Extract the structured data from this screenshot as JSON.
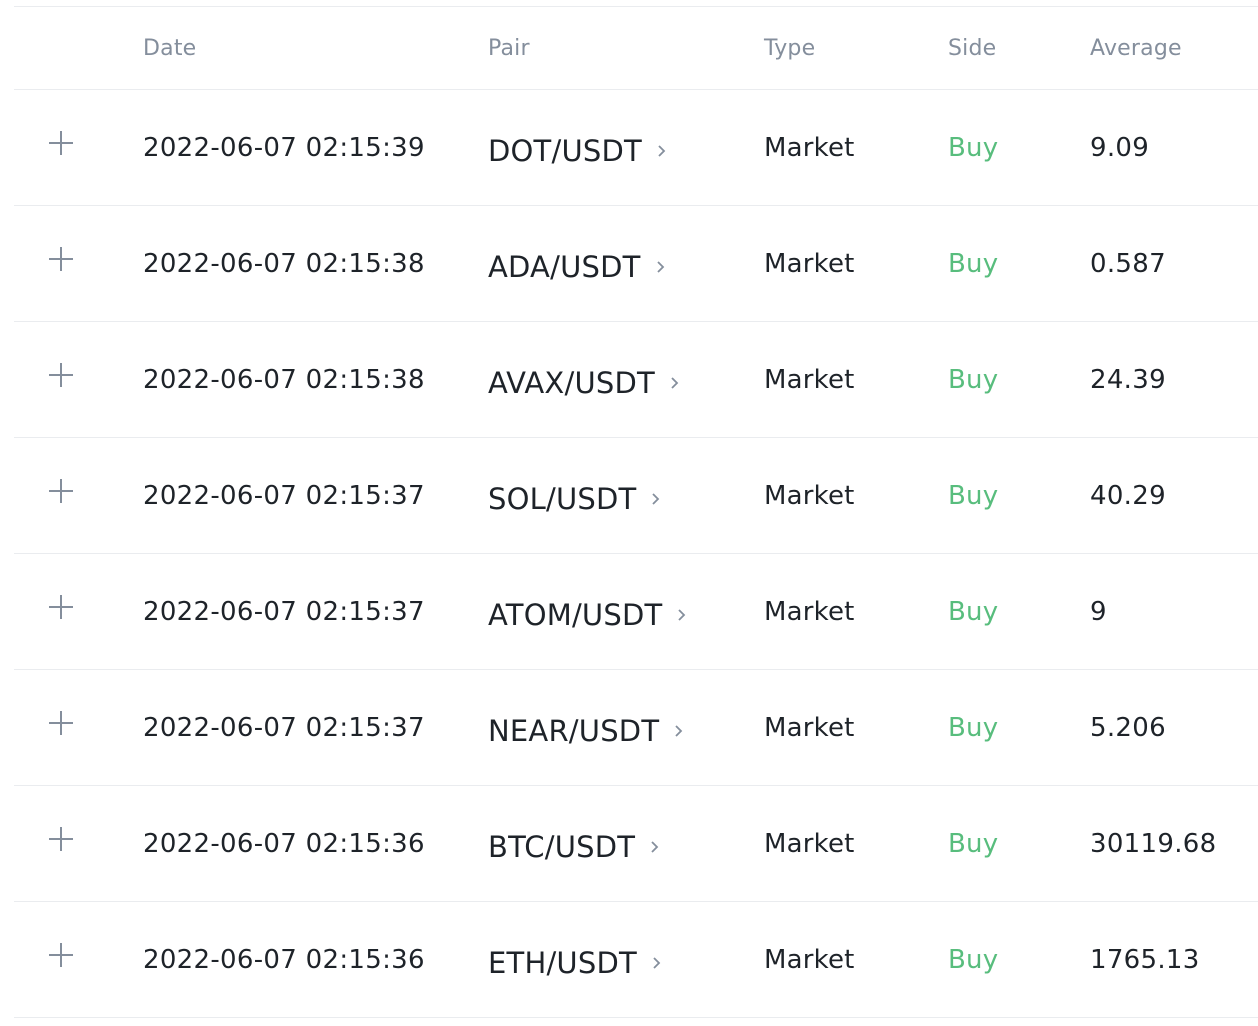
{
  "table": {
    "headers": {
      "date": "Date",
      "pair": "Pair",
      "type": "Type",
      "side": "Side",
      "average": "Average"
    },
    "side_color": "#58bd7d",
    "rows": [
      {
        "date": "2022-06-07 02:15:39",
        "pair": "DOT/USDT",
        "type": "Market",
        "side": "Buy",
        "average": "9.09"
      },
      {
        "date": "2022-06-07 02:15:38",
        "pair": "ADA/USDT",
        "type": "Market",
        "side": "Buy",
        "average": "0.587"
      },
      {
        "date": "2022-06-07 02:15:38",
        "pair": "AVAX/USDT",
        "type": "Market",
        "side": "Buy",
        "average": "24.39"
      },
      {
        "date": "2022-06-07 02:15:37",
        "pair": "SOL/USDT",
        "type": "Market",
        "side": "Buy",
        "average": "40.29"
      },
      {
        "date": "2022-06-07 02:15:37",
        "pair": "ATOM/USDT",
        "type": "Market",
        "side": "Buy",
        "average": "9"
      },
      {
        "date": "2022-06-07 02:15:37",
        "pair": "NEAR/USDT",
        "type": "Market",
        "side": "Buy",
        "average": "5.206"
      },
      {
        "date": "2022-06-07 02:15:36",
        "pair": "BTC/USDT",
        "type": "Market",
        "side": "Buy",
        "average": "30119.68"
      },
      {
        "date": "2022-06-07 02:15:36",
        "pair": "ETH/USDT",
        "type": "Market",
        "side": "Buy",
        "average": "1765.13"
      }
    ],
    "icons": {
      "expand": "plus-icon",
      "pair_link": "chevron-right-icon"
    }
  }
}
